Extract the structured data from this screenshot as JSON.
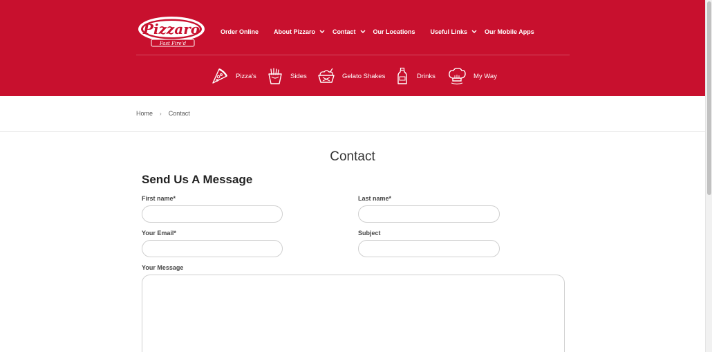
{
  "colors": {
    "brand_red": "#c8102e",
    "white": "#ffffff"
  },
  "logo": {
    "name": "Pizzaro",
    "tagline": "Fast Fire'd"
  },
  "topnav": [
    {
      "label": "Order Online",
      "dropdown": false
    },
    {
      "label": "About Pizzaro",
      "dropdown": true
    },
    {
      "label": "Contact",
      "dropdown": true
    },
    {
      "label": "Our Locations",
      "dropdown": false
    },
    {
      "label": "Useful Links",
      "dropdown": true
    },
    {
      "label": "Our Mobile Apps",
      "dropdown": false
    }
  ],
  "categories": [
    {
      "label": "Pizza's",
      "icon": "pizza-slice-icon"
    },
    {
      "label": "Sides",
      "icon": "fries-icon"
    },
    {
      "label": "Gelato Shakes",
      "icon": "gelato-icon"
    },
    {
      "label": "Drinks",
      "icon": "bottle-icon"
    },
    {
      "label": "My Way",
      "icon": "chef-hat-icon"
    }
  ],
  "breadcrumb": {
    "home": "Home",
    "separator": "›",
    "current": "Contact"
  },
  "page": {
    "title": "Contact",
    "subtitle": "Send Us A Message"
  },
  "form": {
    "first_name": {
      "label": "First name*",
      "value": ""
    },
    "last_name": {
      "label": "Last name*",
      "value": ""
    },
    "email": {
      "label": "Your Email*",
      "value": ""
    },
    "subject": {
      "label": "Subject",
      "value": ""
    },
    "message": {
      "label": "Your Message",
      "value": ""
    }
  }
}
